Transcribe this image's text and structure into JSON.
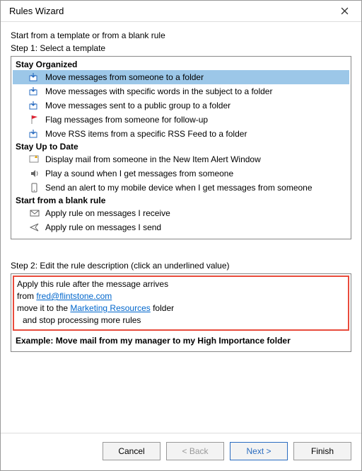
{
  "window": {
    "title": "Rules Wizard"
  },
  "intro": "Start from a template or from a blank rule",
  "step1": {
    "label": "Step 1: Select a template",
    "groups": [
      {
        "header": "Stay Organized",
        "items": [
          {
            "icon": "move-folder-icon",
            "label": "Move messages from someone to a folder",
            "selected": true
          },
          {
            "icon": "move-folder-icon",
            "label": "Move messages with specific words in the subject to a folder"
          },
          {
            "icon": "move-folder-icon",
            "label": "Move messages sent to a public group to a folder"
          },
          {
            "icon": "flag-icon",
            "label": "Flag messages from someone for follow-up"
          },
          {
            "icon": "move-folder-icon",
            "label": "Move RSS items from a specific RSS Feed to a folder"
          }
        ]
      },
      {
        "header": "Stay Up to Date",
        "items": [
          {
            "icon": "alert-window-icon",
            "label": "Display mail from someone in the New Item Alert Window"
          },
          {
            "icon": "sound-icon",
            "label": "Play a sound when I get messages from someone"
          },
          {
            "icon": "mobile-icon",
            "label": "Send an alert to my mobile device when I get messages from someone"
          }
        ]
      },
      {
        "header": "Start from a blank rule",
        "items": [
          {
            "icon": "envelope-icon",
            "label": "Apply rule on messages I receive"
          },
          {
            "icon": "send-icon",
            "label": "Apply rule on messages I send"
          }
        ]
      }
    ]
  },
  "step2": {
    "label": "Step 2: Edit the rule description (click an underlined value)",
    "line1": "Apply this rule after the message arrives",
    "line2_prefix": "from ",
    "from_link": "fred@flintstone.com",
    "line3_prefix": "move it to the ",
    "folder_link": "Marketing Resources",
    "line3_suffix": " folder",
    "line4": "  and stop processing more rules",
    "example": "Example: Move mail from my manager to my High Importance folder"
  },
  "buttons": {
    "cancel": "Cancel",
    "back": "< Back",
    "next": "Next >",
    "finish": "Finish"
  }
}
